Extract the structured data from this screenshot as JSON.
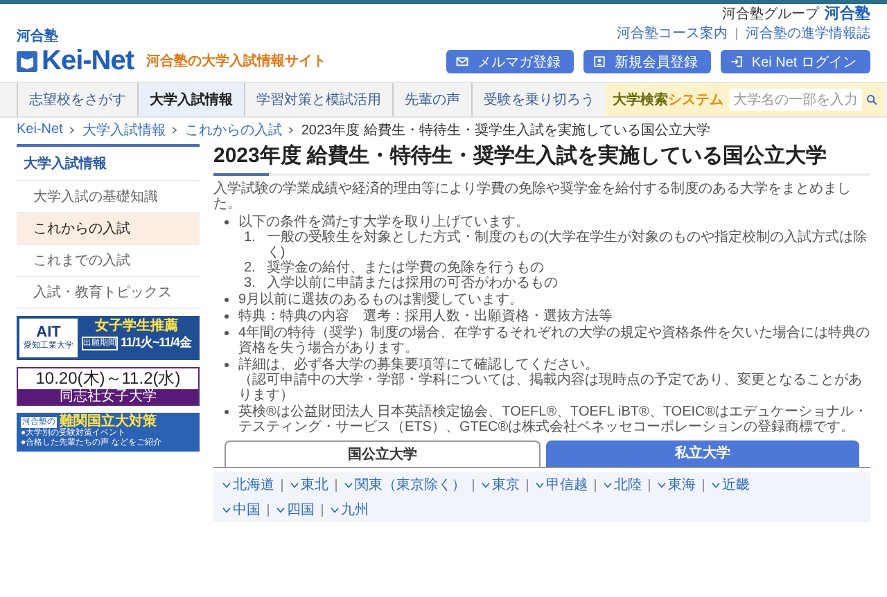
{
  "top_bar": {
    "group_label": "河合塾グループ",
    "group_logo": "河合塾"
  },
  "header": {
    "logo_top": "河合塾",
    "logo_main": "Kei-Net",
    "tagline": "河合塾の大学入試情報サイト",
    "links": [
      "河合塾コース案内",
      "河合塾の進学情報誌"
    ],
    "buttons": [
      {
        "label": "メルマガ登録",
        "kind": "mail"
      },
      {
        "label": "新規会員登録",
        "kind": "card"
      },
      {
        "label": "Kei Net ログイン",
        "kind": "login"
      }
    ]
  },
  "nav": {
    "items": [
      {
        "label": "志望校をさがす",
        "selected": false
      },
      {
        "label": "大学入試情報",
        "selected": true
      },
      {
        "label": "学習対策と模試活用",
        "selected": false
      },
      {
        "label": "先輩の声",
        "selected": false
      },
      {
        "label": "受験を乗り切ろう",
        "selected": false
      }
    ],
    "search_system": {
      "part_1": "大学検索",
      "part_2": "システム"
    },
    "search": {
      "placeholder": "大学名の一部を入力"
    }
  },
  "breadcrumb": [
    "Kei-Net",
    "大学入試情報",
    "これからの入試",
    "2023年度 給費生・特待生・奨学生入試を実施している国公立大学"
  ],
  "sidebar": {
    "title": "大学入試情報",
    "items": [
      {
        "label": "大学入試の基礎知識",
        "selected": false
      },
      {
        "label": "これからの入試",
        "selected": true
      },
      {
        "label": "これまでの入試",
        "selected": false
      },
      {
        "label": "入試・教育トピックス",
        "selected": false
      }
    ],
    "banners": [
      {
        "kind": "ait",
        "logo": "AIT",
        "school": "愛知工業大学",
        "headline": "女子学生推薦",
        "period_label": "出願期間",
        "period": "11/1火~11/4金"
      },
      {
        "kind": "dates",
        "dates": "10.20(木)～11.2(水)",
        "school": "同志社女子大学"
      },
      {
        "kind": "kawai",
        "brand": "河合塾の",
        "headline": "難関国立大対策",
        "lines": [
          "●大学別の受験対策イベント",
          "●合格した先輩たちの声 などをご紹介"
        ]
      }
    ]
  },
  "main": {
    "title": "2023年度 給費生・特待生・奨学生入試を実施している国公立大学",
    "intro": "入学試験の学業成績や経済的理由等により学費の免除や奨学金を給付する制度のある大学をまとめました。",
    "bullets": [
      {
        "text": "以下の条件を満たす大学を取り上げています。",
        "children": [
          {
            "number": "1.",
            "text": "一般の受験生を対象とした方式・制度のもの(大学在学生が対象のものや指定校制の入試方式は除く)"
          },
          {
            "number": "2.",
            "text": "奨学金の給付、または学費の免除を行うもの"
          },
          {
            "number": "3.",
            "text": "入学以前に申請または採用の可否がわかるもの"
          }
        ]
      },
      {
        "text": "9月以前に選抜のあるものは割愛しています。"
      },
      {
        "text": "特典：特典の内容　選考：採用人数・出願資格・選抜方法等"
      },
      {
        "text": "4年間の特待（奨学）制度の場合、在学するそれぞれの大学の規定や資格条件を欠いた場合には特典の資格を失う場合があります。"
      },
      {
        "text": "詳細は、必ず各大学の募集要項等にて確認してください。",
        "note": "（認可申請中の大学・学部・学科については、掲載内容は現時点の予定であり、変更となることがあります）"
      },
      {
        "text": "英検®は公益財団法人 日本英語検定協会、TOEFL®、TOEFL iBT®、TOEIC®はエデュケーショナル・テスティング・サービス（ETS）、GTEC®は株式会社ベネッセコーポレーションの登録商標です。"
      }
    ],
    "tabs": [
      {
        "label": "国公立大学",
        "selected": true
      },
      {
        "label": "私立大学",
        "selected": false
      }
    ],
    "regions": [
      "北海道",
      "東北",
      "関東（東京除く）",
      "東京",
      "甲信越",
      "北陸",
      "東海",
      "近畿",
      "中国",
      "四国",
      "九州"
    ]
  }
}
